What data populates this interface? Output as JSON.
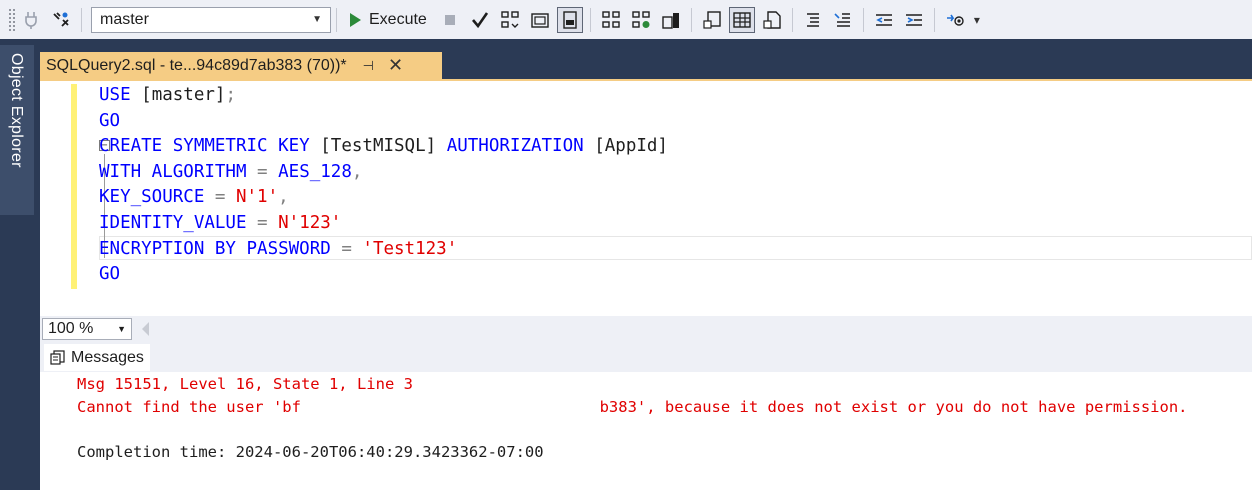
{
  "toolbar": {
    "database": "master",
    "execute_label": "Execute"
  },
  "left_rail": {
    "object_explorer_label": "Object Explorer"
  },
  "document_tab": {
    "title": "SQLQuery2.sql - te...94c89d7ab383 (70))*",
    "pin_glyph": "⊣",
    "close_glyph": "✕"
  },
  "editor": {
    "lines": [
      {
        "tokens": [
          {
            "t": "USE ",
            "c": "kw"
          },
          {
            "t": "[master]",
            "c": "ident"
          },
          {
            "t": ";",
            "c": "op"
          }
        ]
      },
      {
        "tokens": [
          {
            "t": "GO",
            "c": "kw"
          }
        ]
      },
      {
        "tokens": [
          {
            "t": "CREATE SYMMETRIC KEY ",
            "c": "kw"
          },
          {
            "t": "[TestMISQL] ",
            "c": "ident"
          },
          {
            "t": "AUTHORIZATION ",
            "c": "kw"
          },
          {
            "t": "[AppId]",
            "c": "ident"
          }
        ]
      },
      {
        "tokens": [
          {
            "t": "WITH ALGORITHM ",
            "c": "kw"
          },
          {
            "t": "= ",
            "c": "op"
          },
          {
            "t": "AES_128",
            "c": "kw"
          },
          {
            "t": ",",
            "c": "op"
          }
        ]
      },
      {
        "tokens": [
          {
            "t": "KEY_SOURCE ",
            "c": "kw"
          },
          {
            "t": "= ",
            "c": "op"
          },
          {
            "t": "N'1'",
            "c": "str"
          },
          {
            "t": ",",
            "c": "op"
          }
        ]
      },
      {
        "tokens": [
          {
            "t": "IDENTITY_VALUE ",
            "c": "kw"
          },
          {
            "t": "= ",
            "c": "op"
          },
          {
            "t": "N'123'",
            "c": "str"
          }
        ]
      },
      {
        "tokens": [
          {
            "t": "ENCRYPTION BY PASSWORD ",
            "c": "kw"
          },
          {
            "t": "= ",
            "c": "op"
          },
          {
            "t": "'Test123'",
            "c": "str"
          }
        ]
      },
      {
        "tokens": [
          {
            "t": "GO",
            "c": "kw"
          }
        ]
      }
    ]
  },
  "zoom": {
    "value": "100 %"
  },
  "results": {
    "tab_label": "Messages",
    "messages": [
      {
        "text": "Msg 15151, Level 16, State 1, Line 3",
        "kind": "error"
      },
      {
        "text": "Cannot find the user 'bf                                b383', because it does not exist or you do not have permission.",
        "kind": "error"
      },
      {
        "text": "",
        "kind": "normal"
      },
      {
        "text": "Completion time: 2024-06-20T06:40:29.3423362-07:00",
        "kind": "normal"
      }
    ]
  },
  "colors": {
    "keyword": "#0000ff",
    "string": "#e00000",
    "operator": "#808080",
    "tab_active": "#f5cc84",
    "rail": "#2b3a55"
  }
}
